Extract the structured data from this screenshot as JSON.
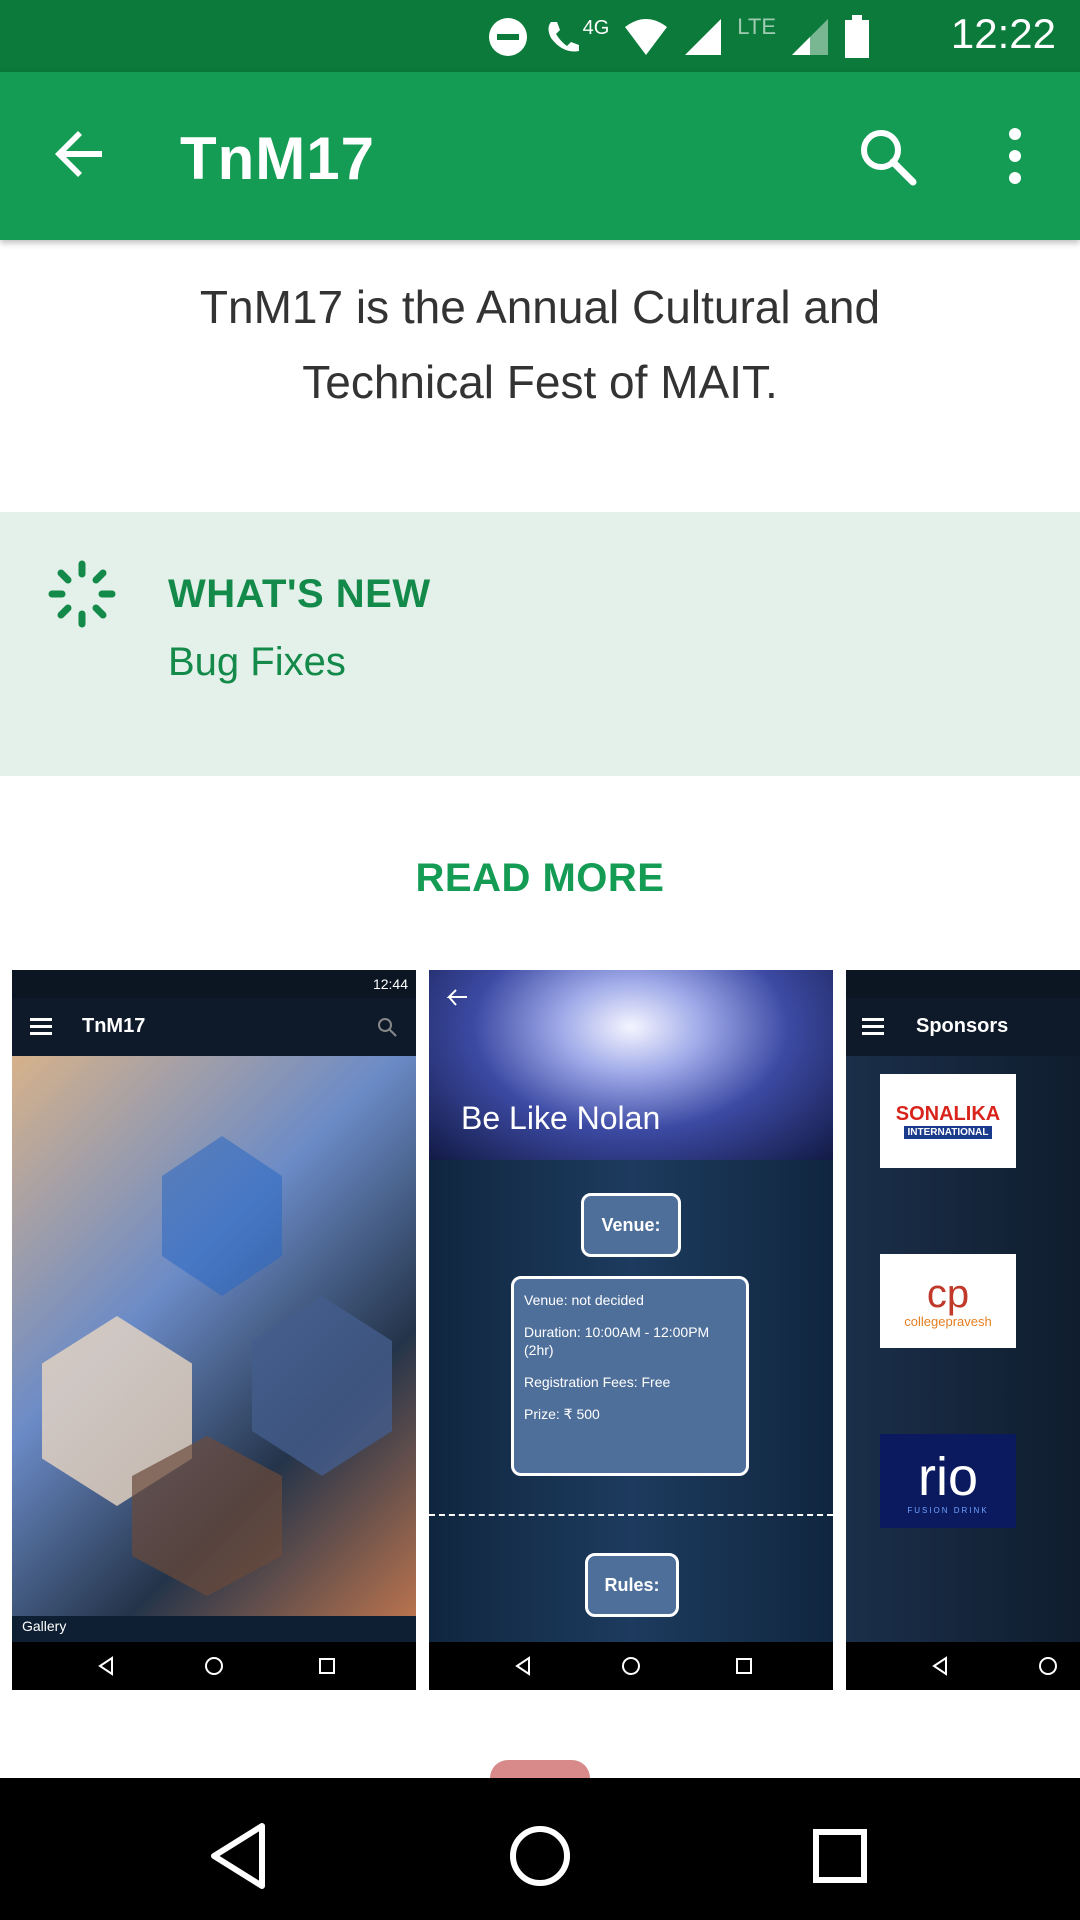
{
  "status_bar": {
    "time": "12:22",
    "network_label": "4G",
    "lte_label": "LTE"
  },
  "app_bar": {
    "title": "TnM17"
  },
  "description": {
    "line1": "TnM17 is the Annual Cultural and",
    "line2": "Technical Fest of MAIT."
  },
  "whats_new": {
    "heading": "WHAT'S NEW",
    "body": "Bug Fixes"
  },
  "read_more": "READ MORE",
  "screenshots": {
    "shot1": {
      "status_time": "12:44",
      "title": "TnM17",
      "footer_label": "Gallery"
    },
    "shot2": {
      "event_title": "Be Like Nolan",
      "venue_button": "Venue:",
      "venue": "Venue: not decided",
      "duration": "Duration: 10:00AM - 12:00PM (2hr)",
      "fees": "Registration Fees: Free",
      "prize": "Prize: ₹ 500",
      "rules_button": "Rules:"
    },
    "shot3": {
      "title": "Sponsors",
      "logos": [
        "SONALIKA",
        "INTERNATIONAL",
        "cp",
        "collegepravesh",
        "rio",
        "FUSION DRINK"
      ]
    }
  },
  "colors": {
    "status_bar": "#0b7a3a",
    "app_bar": "#149c55",
    "accent_text": "#148a4a",
    "whats_new_bg": "#e3f1ea"
  }
}
